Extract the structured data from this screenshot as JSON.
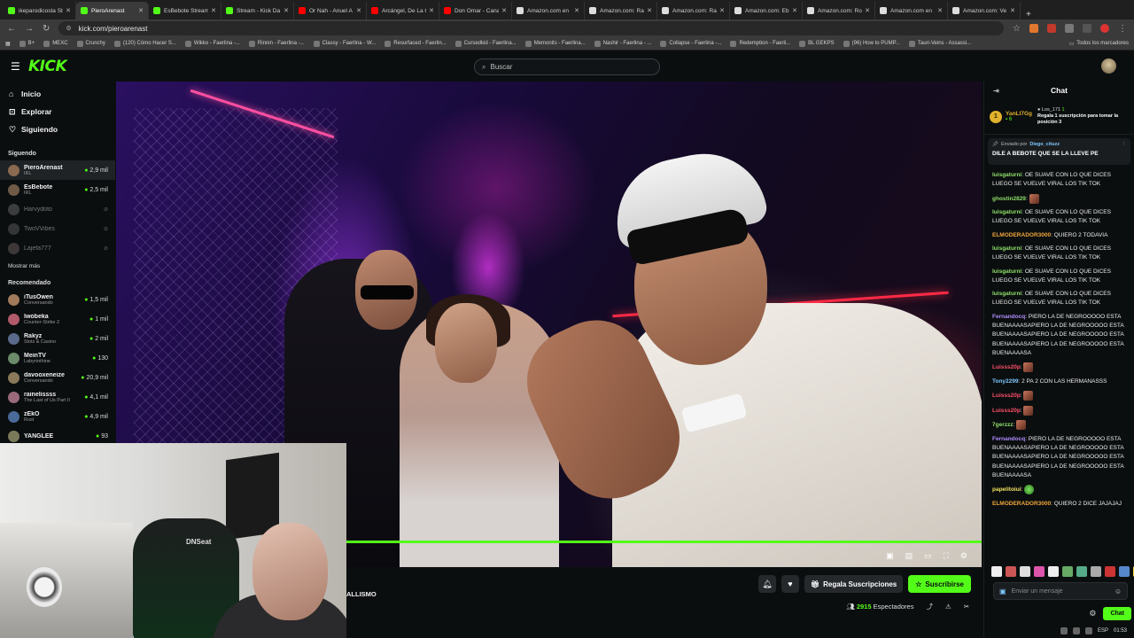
{
  "browser": {
    "tabs": [
      {
        "label": "ikeparodicosta St",
        "color": "#53fc18",
        "active": false
      },
      {
        "label": "PieroArenast",
        "color": "#53fc18",
        "active": true
      },
      {
        "label": "EsBebote Stream",
        "color": "#53fc18",
        "active": false
      },
      {
        "label": "Stream - Kick Da",
        "color": "#53fc18",
        "active": false
      },
      {
        "label": "Or Nah - Anuel A",
        "color": "#ff0000",
        "active": false
      },
      {
        "label": "Arcángel, De La G",
        "color": "#ff0000",
        "active": false
      },
      {
        "label": "Don Omar - Cana",
        "color": "#ff0000",
        "active": false
      },
      {
        "label": "Amazon.com en",
        "color": "#dddddd",
        "active": false
      },
      {
        "label": "Amazon.com: Ra",
        "color": "#dddddd",
        "active": false
      },
      {
        "label": "Amazon.com: Ra",
        "color": "#dddddd",
        "active": false
      },
      {
        "label": "Amazon.com: Eb",
        "color": "#dddddd",
        "active": false
      },
      {
        "label": "Amazon.com: Ro",
        "color": "#dddddd",
        "active": false
      },
      {
        "label": "Amazon.com en",
        "color": "#dddddd",
        "active": false
      },
      {
        "label": "Amazon.com: Ve",
        "color": "#dddddd",
        "active": false
      }
    ],
    "new_tab": "+",
    "url": "kick.com/pieroarenast",
    "bookmarks": [
      "B+",
      "MEXC",
      "Crunchy",
      "(120) Cómo Hacer S...",
      "Wikko - Faerlina -...",
      "Rinnin - Faerlina -...",
      "Classy - Faerlina - W...",
      "Resurfaced - Faerlin...",
      "Cursedkid - Faerlina...",
      "Memonits - Faerlina...",
      "Nashir - Faerlina - ...",
      "Collapse - Faerlina -...",
      "Redemption - Faerli...",
      "BL GEKPS",
      "(96) How to PUMP...",
      "Tauri-Veins - Assassi..."
    ],
    "bookmarks_all": "Todos los marcadores"
  },
  "header": {
    "logo": "KICK",
    "search_placeholder": "Buscar"
  },
  "sidebar": {
    "nav": [
      {
        "label": "Inicio",
        "icon": "home-icon",
        "glyph": "⌂"
      },
      {
        "label": "Explorar",
        "icon": "compass-icon",
        "glyph": "⊡"
      },
      {
        "label": "Siguiendo",
        "icon": "heart-icon",
        "glyph": "♡"
      }
    ],
    "following_title": "Siguendo",
    "following": [
      {
        "name": "PieroArenast",
        "category": "IRL",
        "viewers": "2,9 mil",
        "online": true,
        "active": true,
        "color": "#8a6a50"
      },
      {
        "name": "EsBebote",
        "category": "IRL",
        "viewers": "2,5 mil",
        "online": true,
        "active": false,
        "color": "#6f5a48"
      },
      {
        "name": "Harvydoto",
        "category": "",
        "viewers": "",
        "online": false,
        "active": false,
        "color": "#777777"
      },
      {
        "name": "TwoVVibes",
        "category": "",
        "viewers": "",
        "online": false,
        "active": false,
        "color": "#666666"
      },
      {
        "name": "Lajefa777",
        "category": "",
        "viewers": "",
        "online": false,
        "active": false,
        "color": "#7a6a6a"
      }
    ],
    "show_more": "Mostrar más",
    "recommended_title": "Recomendado",
    "recommended": [
      {
        "name": "iTusOwen",
        "category": "Conversando",
        "viewers": "1,5 mil",
        "color": "#a07a5a"
      },
      {
        "name": "lwobeka",
        "category": "Counter-Strike 2",
        "viewers": "1 mil",
        "color": "#b05a6a"
      },
      {
        "name": "Rakyz",
        "category": "Slots & Casino",
        "viewers": "2 mil",
        "color": "#5a6a8a"
      },
      {
        "name": "MeinTV",
        "category": "Labyrinthine",
        "viewers": "130",
        "color": "#6a8a6a"
      },
      {
        "name": "davooxeneize",
        "category": "Conversando",
        "viewers": "20,9 mil",
        "color": "#8a7a5a"
      },
      {
        "name": "rainelissss",
        "category": "The Last of Us Part II",
        "viewers": "4,1 mil",
        "color": "#9a6a7a"
      },
      {
        "name": "zEkO",
        "category": "Rust",
        "viewers": "4,9 mil",
        "color": "#4a6a9a"
      },
      {
        "name": "YANGLEE",
        "category": "",
        "viewers": "93",
        "color": "#7a7a5a"
      }
    ]
  },
  "video": {
    "title_fragment": "ALLISMO",
    "controls": [
      "pip-icon",
      "miniplayer-icon",
      "theater-icon",
      "fullscreen-icon",
      "settings-icon"
    ],
    "gift_label": "Regala Suscripciones",
    "subscribe_label": "Suscribirse",
    "viewers_count": "2915",
    "viewers_label": "Espectadores",
    "chair_brand": "DNSeat"
  },
  "chat": {
    "title": "Chat",
    "top_gifter": {
      "rank": "1",
      "name": "YanLI7Gg",
      "count": "6"
    },
    "second": {
      "name": "Los_171",
      "count": "1",
      "text": "Regala 1 suscripción para tomar la posición 3"
    },
    "pinned": {
      "label": "Enviado por",
      "user": "Diego_cituzz",
      "text": "DILE A BEBOTE QUE SE LA LLEVE PE"
    },
    "messages": [
      {
        "user": "luisgaturni",
        "color": "#8ee06a",
        "text": "OE SUAVE CON LO QUE DICES LUEGO SE VUELVE VIRAL LOS TIK TOK"
      },
      {
        "user": "ghostin2829",
        "color": "#8ee06a",
        "text": "",
        "emote": true
      },
      {
        "user": "luisgaturni",
        "color": "#8ee06a",
        "text": "OE SUAVE CON LO QUE DICES LUEGO SE VUELVE VIRAL LOS TIK TOK"
      },
      {
        "user": "ELMODERADOR3000",
        "color": "#f0a63c",
        "text": "QUIERO 2 TODAVIA"
      },
      {
        "user": "luisgaturni",
        "color": "#8ee06a",
        "text": "OE SUAVE CON LO QUE DICES LUEGO SE VUELVE VIRAL LOS TIK TOK"
      },
      {
        "user": "luisgaturni",
        "color": "#8ee06a",
        "text": "OE SUAVE CON LO QUE DICES LUEGO SE VUELVE VIRAL LOS TIK TOK"
      },
      {
        "user": "luisgaturni",
        "color": "#8ee06a",
        "text": "OE SUAVE CON LO QUE DICES LUEGO SE VUELVE VIRAL LOS TIK TOK"
      },
      {
        "user": "Fernandocq",
        "color": "#b08cff",
        "text": "PIERO LA DE NEGROOOOO ESTA BUENAAAASAPIERO LA DE NEGROOOOO ESTA BUENAAAASAPIERO LA DE NEGROOOOO ESTA BUENAAAASAPIERO LA DE NEGROOOOO ESTA BUENAAAASA"
      },
      {
        "user": "Luisss20p",
        "color": "#ff4f6a",
        "text": "",
        "emote": true
      },
      {
        "user": "Tony2299",
        "color": "#7ec8ff",
        "text": "2 PA 2 CON LAS HERMANASSS"
      },
      {
        "user": "Luisss20p",
        "color": "#ff4f6a",
        "text": "",
        "emote": true
      },
      {
        "user": "Luisss20p",
        "color": "#ff4f6a",
        "text": "",
        "emote": true
      },
      {
        "user": "7gerzzz",
        "color": "#8ee06a",
        "text": "",
        "emote": true
      },
      {
        "user": "Fernandocq",
        "color": "#b08cff",
        "text": "PIERO LA DE NEGROOOOO ESTA BUENAAAASAPIERO LA DE NEGROOOOO ESTA BUENAAAASAPIERO LA DE NEGROOOOO ESTA BUENAAAASAPIERO LA DE NEGROOOOO ESTA BUENAAAASA"
      },
      {
        "user": "papelitoiui",
        "color": "#f0e060",
        "text": "",
        "emote": true,
        "emote_green": true
      },
      {
        "user": "ELMODERADOR3000",
        "color": "#f0a63c",
        "text": "QUIERO 2 DICE JAJAJAJ"
      }
    ],
    "input_placeholder": "Enviar un mensaje",
    "chat_button": "Chat"
  },
  "tray": {
    "lang": "ESP",
    "time": "01:53"
  },
  "colors": {
    "accent": "#53fc18",
    "bg": "#0b0e0f"
  }
}
